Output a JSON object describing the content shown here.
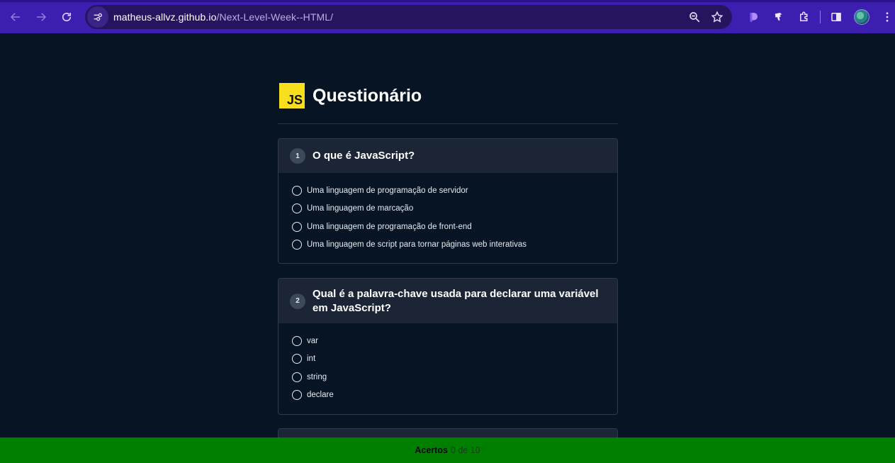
{
  "browser": {
    "url_host": "matheus-allvz.github.io",
    "url_path": "/Next-Level-Week--HTML/",
    "icons": [
      "back-icon",
      "forward-icon",
      "reload-icon",
      "site-settings-icon",
      "zoom-icon",
      "bookmark-star-icon",
      "extension-icon",
      "extensions-puzzle-icon",
      "side-panel-icon",
      "profile-avatar",
      "menu-icon"
    ],
    "accent": "#3c1fb0"
  },
  "header": {
    "logo_text": "JS",
    "title": "Questionário"
  },
  "questions": [
    {
      "number": "1",
      "text": "O que é JavaScript?",
      "options": [
        "Uma linguagem de programação de servidor",
        "Uma linguagem de marcação",
        "Uma linguagem de programação de front-end",
        "Uma linguagem de script para tornar páginas web interativas"
      ]
    },
    {
      "number": "2",
      "text": "Qual é a palavra-chave usada para declarar uma variável em JavaScript?",
      "options": [
        "var",
        "int",
        "string",
        "declare"
      ]
    }
  ],
  "footer": {
    "label": "Acertos",
    "value": "0 de 10",
    "color": "#008000"
  }
}
